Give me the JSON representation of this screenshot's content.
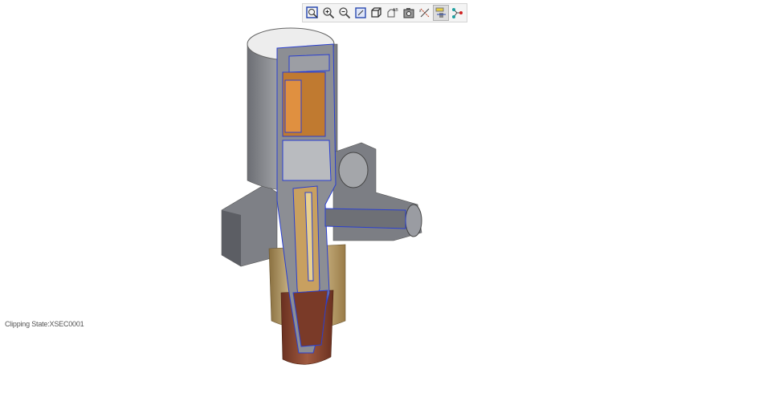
{
  "toolbar": {
    "buttons": [
      {
        "icon": "zoom-fit-icon",
        "active": false
      },
      {
        "icon": "zoom-in-icon",
        "active": false
      },
      {
        "icon": "zoom-out-icon",
        "active": false
      },
      {
        "icon": "refit-view-icon",
        "active": false
      },
      {
        "icon": "display-style-icon",
        "active": false
      },
      {
        "icon": "annotation-display-icon",
        "active": false
      },
      {
        "icon": "saved-views-icon",
        "active": false
      },
      {
        "icon": "datum-display-icon",
        "active": false
      },
      {
        "icon": "section-clipping-icon",
        "active": true
      },
      {
        "icon": "model-tree-icon",
        "active": false
      }
    ]
  },
  "status": {
    "clipping_state": "Clipping State:XSEC0001"
  },
  "colors": {
    "accent": "#2a3fd0",
    "brass": "#c8a060",
    "copper": "#8a4a30",
    "steel": "#8e9096"
  }
}
